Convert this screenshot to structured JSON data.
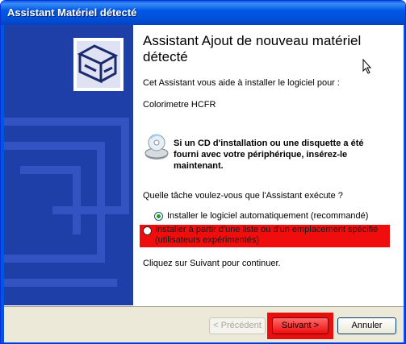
{
  "window": {
    "title": "Assistant Matériel détecté"
  },
  "wizard": {
    "heading": "Assistant Ajout de nouveau matériel détecté",
    "intro": "Cet Assistant vous aide à installer le logiciel pour :",
    "device_name": "Colorimetre HCFR",
    "cd_notice": "Si un CD d'installation ou une disquette a été fourni avec votre périphérique, insérez-le maintenant.",
    "question": "Quelle tâche voulez-vous que l'Assistant exécute ?",
    "options": [
      {
        "label": "Installer le logiciel automatiquement (recommandé)",
        "selected": true
      },
      {
        "label": "Installer à partir d'une liste ou d'un emplacement spécifié (utilisateurs expérimentés)",
        "selected": false
      }
    ],
    "continue_text": "Cliquez sur Suivant pour continuer."
  },
  "buttons": {
    "back": "< Précédent",
    "next": "Suivant >",
    "cancel": "Annuler"
  },
  "icons": [
    "hardware-install-icon",
    "cd-icon",
    "mouse-cursor-icon"
  ],
  "colors": {
    "titlebar": "#0055e5",
    "sidepanel": "#1f3fa8",
    "highlight": "#f00d0d",
    "radio_dot": "#21a121"
  }
}
